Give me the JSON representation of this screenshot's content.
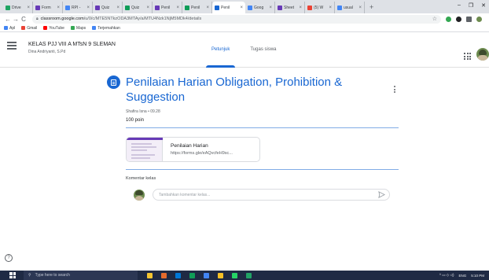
{
  "browser": {
    "tabs": [
      {
        "title": "Drive",
        "color": "#1fa463"
      },
      {
        "title": "Form",
        "color": "#673ab7"
      },
      {
        "title": "RPI -",
        "color": "#4285f4"
      },
      {
        "title": "Quiz",
        "color": "#673ab7"
      },
      {
        "title": "Quiz",
        "color": "#0f9d58"
      },
      {
        "title": "Penil",
        "color": "#673ab7"
      },
      {
        "title": "Penil",
        "color": "#0f9d58"
      },
      {
        "title": "Penil",
        "color": "#1967d2",
        "active": true
      },
      {
        "title": "Goog",
        "color": "#4285f4"
      },
      {
        "title": "Sheet",
        "color": "#673ab7"
      },
      {
        "title": "(5) W",
        "color": "#ea4335"
      },
      {
        "title": "usual",
        "color": "#4285f4"
      }
    ],
    "new_tab": "+",
    "window_controls": [
      "–",
      "❐",
      "✕"
    ],
    "nav": {
      "back": "←",
      "forward": "→",
      "reload": "C"
    },
    "url_host": "classroom.google.com",
    "url_path": "/u/0/c/MTE5NTkzODA3MTAy/a/MTU4Nzk1NjM5MDk4/details",
    "bookmarks": [
      {
        "label": "Apl",
        "color": "#4285f4"
      },
      {
        "label": "Gmail",
        "color": "#ea4335"
      },
      {
        "label": "YouTube",
        "color": "#ff0000"
      },
      {
        "label": "Maps",
        "color": "#34a853"
      },
      {
        "label": "Terjemahkan",
        "color": "#4285f4"
      }
    ]
  },
  "header": {
    "class_name": "KELAS PJJ VIII A MTsN 9 SLEMAN",
    "teacher": "Dina Andriyanti, S.Pd",
    "tabs": [
      {
        "label": "Petunjuk",
        "active": true
      },
      {
        "label": "Tugas siswa",
        "active": false
      }
    ]
  },
  "assignment": {
    "title": "Penilaian Harian Obligation, Prohibition & Suggestion",
    "meta": "Shafira Isna • 09.28",
    "points": "100 poin",
    "attachment": {
      "title": "Penilaian Harian",
      "url": "https://forms.gle/eAQvcfeH9sc..."
    }
  },
  "comments": {
    "label": "Komentar kelas",
    "placeholder": "Tambahkan komentar kelas..."
  },
  "help": "?",
  "taskbar": {
    "search_placeholder": "Type here to search",
    "apps": [
      "#f4c430",
      "#e56b2d",
      "#0078d7",
      "#0f9d58",
      "#4285f4",
      "#f6c026",
      "#25d366",
      "#21a366"
    ],
    "language": "ENG",
    "time": "5:10 PM",
    "tray_icons": "^ ▭ ◇ ◁)"
  },
  "colors": {
    "accent": "#1967d2",
    "forms_purple": "#673ab7"
  }
}
